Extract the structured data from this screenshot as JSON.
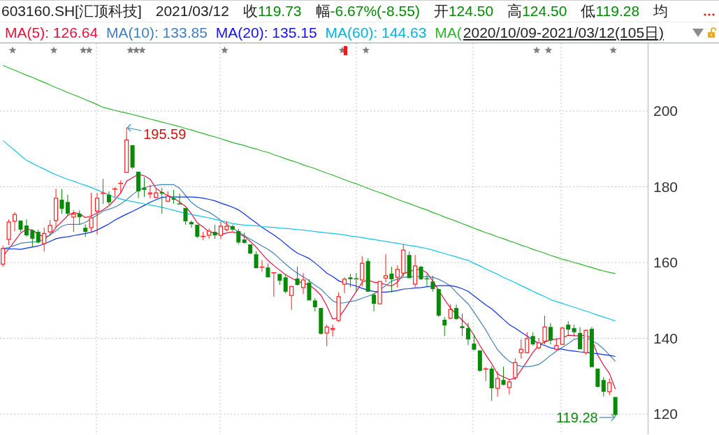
{
  "header": {
    "symbol": "603160.SH[汇顶科技]",
    "date": "2021/03/12",
    "falling": true,
    "quote_fields": [
      {
        "label": "收",
        "value": "119.73"
      },
      {
        "label": "幅",
        "value": "-6.67%(-8.55)"
      },
      {
        "label": "开",
        "value": "124.50"
      },
      {
        "label": "高",
        "value": "124.50"
      },
      {
        "label": "低",
        "value": "119.28"
      },
      {
        "label": "均"
      }
    ]
  },
  "indicator_bar": {
    "ma_items": [
      {
        "text": "MA(5): 126.64",
        "color": "#e8103a"
      },
      {
        "text": "MA(10): 133.85",
        "color": "#3f7fc0"
      },
      {
        "text": "MA(20): 135.15",
        "color": "#1212f0"
      },
      {
        "text": "MA(60): 144.63",
        "color": "#00b4d8"
      },
      {
        "text": "MA(",
        "color": "#2fb02f"
      }
    ],
    "date_range": "2020/10/09-2021/03/12(105日)"
  },
  "chart": {
    "event_marks": [
      {
        "kind": "star"
      },
      {
        "kind": "star"
      },
      {
        "kind": "star"
      },
      {
        "kind": "star"
      },
      {
        "kind": "star"
      },
      {
        "kind": "star"
      },
      {
        "kind": "star"
      },
      {
        "kind": "star"
      },
      {
        "kind": "star"
      },
      {
        "kind": "flag"
      },
      {
        "kind": "star"
      },
      {
        "kind": "star"
      },
      {
        "kind": "star"
      },
      {
        "kind": "star"
      }
    ],
    "chart_data": {
      "type": "candlestick",
      "grid": true,
      "ylim": [
        114.65,
        217.9
      ],
      "yticks": [
        120,
        140,
        160,
        180,
        200
      ],
      "categories": [
        null,
        null,
        null,
        null,
        null,
        null,
        null,
        null,
        null,
        null,
        null,
        null,
        null,
        null,
        null,
        null,
        null,
        null,
        null,
        null,
        null,
        null,
        null,
        null,
        null,
        null,
        null,
        null,
        null,
        null,
        null,
        null,
        null,
        null,
        null,
        null,
        null,
        null,
        null,
        null,
        null,
        null,
        null,
        null,
        null,
        null,
        null,
        null,
        null,
        null,
        null,
        null,
        null,
        null,
        null,
        null,
        null,
        null,
        null,
        null,
        null,
        null,
        null,
        null,
        null,
        null,
        null,
        null,
        null,
        null,
        null,
        null,
        null,
        null,
        null,
        null,
        null,
        null,
        null,
        null,
        null,
        null,
        null,
        null,
        null,
        null,
        null,
        null,
        null,
        null,
        null,
        null,
        null,
        null,
        null,
        null,
        null,
        null,
        null,
        null,
        null,
        null,
        null,
        null,
        null,
        null,
        null,
        null,
        null,
        null
      ],
      "ohlc": [
        [
          159.6,
          164.5,
          158.9,
          163.7
        ],
        [
          166.1,
          171.4,
          164.6,
          170.7
        ],
        [
          170.9,
          173.3,
          168.3,
          172.7
        ],
        [
          171.1,
          171.1,
          168.1,
          168.7
        ],
        [
          169.8,
          171.4,
          166.8,
          167.2
        ],
        [
          168.5,
          168.7,
          164.1,
          166.3
        ],
        [
          168.1,
          168.7,
          165.0,
          165.3
        ],
        [
          165.0,
          169.2,
          162.9,
          167.7
        ],
        [
          168.1,
          171.2,
          167.4,
          169.8
        ],
        [
          171.1,
          179.5,
          169.2,
          177.0
        ],
        [
          176.6,
          179.4,
          172.9,
          174.2
        ],
        [
          176.0,
          177.9,
          172.4,
          172.9
        ],
        [
          172.0,
          173.8,
          168.1,
          172.8
        ],
        [
          172.9,
          173.8,
          170.1,
          172.0
        ],
        [
          169.2,
          170.1,
          166.8,
          168.1
        ],
        [
          169.2,
          178.4,
          168.1,
          171.8
        ],
        [
          173.6,
          178.4,
          167.4,
          177.0
        ],
        [
          178.1,
          182.1,
          175.5,
          178.3
        ],
        [
          177.9,
          178.8,
          175.3,
          175.9
        ],
        [
          179.2,
          179.9,
          177.3,
          179.4
        ],
        [
          180.7,
          181.7,
          178.2,
          180.9
        ],
        [
          183.8,
          195.59,
          183.8,
          192.4
        ],
        [
          191.0,
          191.0,
          184.7,
          185.1
        ],
        [
          184.0,
          184.0,
          177.0,
          178.8
        ],
        [
          179.7,
          182.5,
          177.3,
          179.2
        ],
        [
          178.1,
          180.5,
          177.0,
          178.4
        ],
        [
          177.2,
          179.7,
          177.0,
          178.4
        ],
        [
          178.6,
          179.7,
          172.9,
          178.2
        ],
        [
          176.2,
          178.8,
          176.0,
          177.5
        ],
        [
          177.0,
          179.2,
          175.5,
          176.6
        ],
        [
          175.5,
          178.2,
          175.3,
          175.3
        ],
        [
          174.4,
          174.4,
          170.0,
          170.9
        ],
        [
          170.7,
          171.1,
          169.2,
          170.1
        ],
        [
          170.0,
          170.0,
          166.5,
          166.8
        ],
        [
          166.7,
          168.1,
          165.9,
          166.9
        ],
        [
          167.2,
          169.0,
          166.3,
          168.3
        ],
        [
          168.1,
          170.0,
          166.3,
          167.2
        ],
        [
          167.2,
          170.9,
          166.3,
          169.6
        ],
        [
          168.7,
          170.9,
          168.3,
          169.6
        ],
        [
          169.6,
          170.0,
          168.3,
          168.7
        ],
        [
          168.3,
          168.9,
          164.8,
          165.3
        ],
        [
          166.1,
          167.9,
          165.0,
          165.2
        ],
        [
          164.8,
          164.8,
          162.2,
          162.4
        ],
        [
          162.2,
          163.0,
          158.5,
          158.5
        ],
        [
          158.6,
          160.6,
          157.6,
          158.8
        ],
        [
          158.7,
          159.8,
          156.1,
          156.1
        ],
        [
          157.1,
          157.4,
          151.0,
          157.3
        ],
        [
          157.0,
          157.0,
          154.1,
          155.2
        ],
        [
          156.1,
          157.0,
          151.9,
          152.3
        ],
        [
          151.3,
          153.7,
          147.5,
          153.7
        ],
        [
          155.8,
          158.9,
          153.9,
          154.1
        ],
        [
          153.4,
          157.2,
          151.7,
          155.4
        ],
        [
          154.7,
          155.6,
          150.0,
          150.0
        ],
        [
          150.0,
          150.6,
          147.1,
          148.2
        ],
        [
          148.0,
          148.0,
          141.0,
          141.2
        ],
        [
          141.4,
          143.6,
          137.9,
          143.0
        ],
        [
          142.3,
          143.6,
          140.5,
          142.6
        ],
        [
          144.7,
          152.1,
          144.3,
          151.0
        ],
        [
          154.3,
          156.1,
          151.9,
          155.6
        ],
        [
          156.1,
          157.0,
          153.5,
          155.6
        ],
        [
          155.7,
          157.2,
          152.3,
          155.5
        ],
        [
          155.4,
          161.7,
          153.7,
          159.8
        ],
        [
          160.4,
          161.1,
          152.3,
          152.3
        ],
        [
          151.5,
          151.9,
          147.1,
          149.1
        ],
        [
          149.1,
          155.0,
          149.1,
          155.0
        ],
        [
          155.9,
          162.2,
          154.8,
          156.5
        ],
        [
          157.1,
          158.9,
          152.1,
          155.6
        ],
        [
          156.1,
          159.3,
          153.4,
          158.2
        ],
        [
          157.2,
          164.8,
          156.3,
          163.3
        ],
        [
          162.0,
          162.9,
          155.8,
          155.9
        ],
        [
          154.3,
          162.0,
          153.5,
          159.1
        ],
        [
          158.9,
          159.1,
          155.4,
          155.6
        ],
        [
          155.7,
          157.0,
          153.7,
          155.5
        ],
        [
          155.0,
          156.5,
          152.3,
          153.0
        ],
        [
          153.0,
          153.0,
          145.6,
          146.0
        ],
        [
          144.9,
          145.6,
          140.6,
          143.4
        ],
        [
          145.3,
          148.9,
          145.1,
          147.6
        ],
        [
          148.0,
          148.9,
          144.9,
          145.1
        ],
        [
          143.2,
          146.5,
          140.6,
          142.7
        ],
        [
          142.7,
          144.1,
          138.2,
          139.7
        ],
        [
          138.6,
          141.0,
          136.8,
          137.0
        ],
        [
          136.8,
          136.8,
          131.2,
          131.4
        ],
        [
          131.7,
          132.4,
          128.7,
          131.9
        ],
        [
          132.0,
          132.7,
          123.5,
          126.8
        ],
        [
          126.8,
          131.2,
          124.6,
          129.4
        ],
        [
          129.0,
          132.5,
          127.6,
          127.7
        ],
        [
          127.0,
          129.0,
          125.2,
          128.5
        ],
        [
          129.6,
          134.7,
          129.0,
          133.6
        ],
        [
          136.2,
          139.7,
          134.6,
          137.1
        ],
        [
          136.2,
          141.6,
          136.0,
          139.9
        ],
        [
          140.6,
          141.6,
          138.1,
          138.4
        ],
        [
          137.5,
          140.1,
          137.1,
          138.8
        ],
        [
          139.2,
          146.0,
          138.4,
          143.0
        ],
        [
          143.0,
          144.0,
          138.4,
          139.4
        ],
        [
          137.1,
          139.9,
          136.8,
          138.1
        ],
        [
          138.4,
          143.0,
          138.2,
          142.7
        ],
        [
          143.6,
          144.5,
          140.6,
          142.3
        ],
        [
          142.7,
          143.6,
          140.5,
          141.6
        ],
        [
          141.4,
          142.9,
          137.1,
          137.1
        ],
        [
          136.2,
          142.3,
          135.7,
          142.1
        ],
        [
          142.5,
          143.0,
          132.4,
          132.4
        ],
        [
          132.0,
          132.0,
          127.0,
          127.2
        ],
        [
          129.0,
          129.8,
          124.6,
          125.9
        ],
        [
          125.9,
          129.4,
          125.0,
          128.3
        ],
        [
          124.5,
          124.5,
          119.28,
          119.73
        ],
        null,
        null,
        null,
        null,
        null
      ],
      "series": [
        {
          "type": "line",
          "color": "#e0143c",
          "values": [
            161.7,
            163.6,
            165.7,
            167.8,
            168.8,
            168.6,
            167.5,
            166.7,
            167.2,
            169.3,
            170.8,
            172.4,
            173.2,
            172.9,
            171.9,
            172.3,
            173.1,
            173.9,
            175.0,
            176.6,
            178.4,
            181.5,
            182.4,
            183.3,
            182.9,
            182.0,
            179.6,
            178.5,
            177.7,
            177.0,
            176.0,
            174.8,
            172.9,
            170.5,
            169.4,
            168.1,
            167.8,
            167.4,
            167.8,
            168.1,
            167.6,
            166.9,
            165.6,
            164.1,
            162.3,
            160.6,
            159.2,
            158.0,
            156.8,
            155.9,
            155.1,
            154.5,
            154.1,
            152.9,
            151.4,
            148.6,
            145.1,
            145.4,
            147.6,
            150.0,
            152.4,
            154.8,
            155.4,
            154.8,
            154.6,
            154.2,
            153.8,
            154.8,
            157.0,
            157.6,
            158.1,
            158.2,
            157.3,
            155.1,
            152.7,
            150.2,
            148.0,
            146.3,
            144.8,
            143.2,
            140.8,
            138.1,
            135.6,
            133.3,
            130.6,
            129.8,
            129.1,
            129.4,
            131.6,
            133.9,
            136.3,
            138.2,
            139.0,
            139.6,
            139.8,
            140.1,
            140.8,
            140.7,
            140.6,
            140.9,
            139.8,
            135.6,
            132.9,
            130.7,
            126.6,
            null,
            null,
            null,
            null,
            null
          ]
        },
        {
          "type": "line",
          "color": "#4682b4",
          "values": [
            163.7,
            164.0,
            164.5,
            165.1,
            165.3,
            165.4,
            165.5,
            166.2,
            167.3,
            168.4,
            169.6,
            170.1,
            170.1,
            170.1,
            170.6,
            171.6,
            172.5,
            173.6,
            174.1,
            174.6,
            175.5,
            176.6,
            177.9,
            179.1,
            179.8,
            180.2,
            180.4,
            180.6,
            180.6,
            180.6,
            179.6,
            177.7,
            175.9,
            174.7,
            173.9,
            173.3,
            172.3,
            171.1,
            170.1,
            169.1,
            168.1,
            167.1,
            166.2,
            165.3,
            164.4,
            163.5,
            162.4,
            161.0,
            159.6,
            158.3,
            157.2,
            156.2,
            155.2,
            154.0,
            153.0,
            151.4,
            149.9,
            149.2,
            149.4,
            149.7,
            150.0,
            150.6,
            151.1,
            151.7,
            152.8,
            153.9,
            155.1,
            155.6,
            156.1,
            156.2,
            156.3,
            156.3,
            156.3,
            156.1,
            155.6,
            154.8,
            153.8,
            152.1,
            150.6,
            149.1,
            146.9,
            144.6,
            142.2,
            139.5,
            137.0,
            135.3,
            133.9,
            133.1,
            132.6,
            132.5,
            132.7,
            133.1,
            134.2,
            135.5,
            136.6,
            137.6,
            138.6,
            139.7,
            140.1,
            140.1,
            139.4,
            138.5,
            137.2,
            135.6,
            133.9,
            null,
            null,
            null,
            null,
            null
          ]
        },
        {
          "type": "line",
          "color": "#0b2ff0",
          "values": [
            163.7,
            163.6,
            163.6,
            163.5,
            163.8,
            164.1,
            164.4,
            164.9,
            165.6,
            166.3,
            166.6,
            166.8,
            167.1,
            167.4,
            167.7,
            168.0,
            168.6,
            169.4,
            170.2,
            171.2,
            172.0,
            172.8,
            173.5,
            174.3,
            175.1,
            175.9,
            176.6,
            177.2,
            177.3,
            177.3,
            177.3,
            177.3,
            177.3,
            177.2,
            177.0,
            176.7,
            176.3,
            175.7,
            175.2,
            174.6,
            173.9,
            172.8,
            171.6,
            170.5,
            169.3,
            168.3,
            167.3,
            166.2,
            164.9,
            163.6,
            162.5,
            161.8,
            161.1,
            159.9,
            158.6,
            157.2,
            156.3,
            155.2,
            154.6,
            154.2,
            153.8,
            153.2,
            152.7,
            152.4,
            152.2,
            152.2,
            152.4,
            152.6,
            153.0,
            153.1,
            153.3,
            153.4,
            153.6,
            153.7,
            153.9,
            153.9,
            153.9,
            153.6,
            153.1,
            152.4,
            151.2,
            150.0,
            148.8,
            147.8,
            146.4,
            145.0,
            143.6,
            142.7,
            141.6,
            140.6,
            139.6,
            138.6,
            138.1,
            137.5,
            137.2,
            137.1,
            136.8,
            136.6,
            136.4,
            136.3,
            136.1,
            135.9,
            135.7,
            135.5,
            135.2,
            null,
            null,
            null,
            null,
            null
          ]
        },
        {
          "type": "line",
          "color": "#12c4e4",
          "values": [
            192.2,
            190.9,
            189.6,
            188.3,
            187.0,
            186.2,
            185.4,
            184.7,
            183.9,
            183.2,
            182.6,
            182.0,
            181.5,
            180.9,
            180.4,
            179.8,
            179.2,
            178.5,
            177.9,
            177.2,
            176.8,
            176.4,
            176.1,
            175.8,
            175.5,
            175.2,
            174.9,
            174.6,
            174.2,
            173.8,
            173.4,
            173.0,
            172.7,
            172.4,
            172.1,
            171.8,
            171.4,
            171.1,
            170.7,
            170.3,
            170.1,
            169.9,
            169.8,
            169.7,
            169.5,
            169.4,
            169.3,
            169.1,
            169.0,
            168.9,
            168.7,
            168.6,
            168.4,
            168.2,
            168.0,
            167.8,
            167.7,
            167.5,
            167.3,
            167.0,
            166.8,
            166.6,
            166.3,
            166.1,
            165.8,
            165.6,
            165.3,
            165.1,
            164.8,
            164.5,
            164.3,
            164.0,
            163.7,
            163.3,
            162.8,
            162.4,
            161.9,
            161.5,
            161.0,
            160.6,
            159.8,
            159.1,
            158.3,
            157.6,
            156.9,
            156.1,
            155.4,
            154.7,
            153.9,
            153.2,
            152.4,
            151.7,
            151.0,
            150.2,
            149.7,
            149.2,
            148.7,
            148.2,
            147.7,
            147.2,
            146.7,
            146.1,
            145.6,
            145.1,
            144.6,
            null,
            null,
            null,
            null,
            null
          ]
        },
        {
          "type": "line",
          "color": "#2db32d",
          "values": [
            212.1,
            211.4,
            210.8,
            210.1,
            209.5,
            208.9,
            208.2,
            207.6,
            206.9,
            206.2,
            205.6,
            204.9,
            204.3,
            203.7,
            203.0,
            202.4,
            201.7,
            201.0,
            200.6,
            200.2,
            199.8,
            199.5,
            199.1,
            198.7,
            198.3,
            197.9,
            197.5,
            197.1,
            196.7,
            196.3,
            195.9,
            195.4,
            195.0,
            194.5,
            194.1,
            193.6,
            193.2,
            192.7,
            192.2,
            191.7,
            191.3,
            190.9,
            190.4,
            190.0,
            189.5,
            189.1,
            188.5,
            188.0,
            187.4,
            186.9,
            186.4,
            185.8,
            185.3,
            184.8,
            184.2,
            183.6,
            183.1,
            182.5,
            181.9,
            181.3,
            180.8,
            180.2,
            179.6,
            179.0,
            178.5,
            177.9,
            177.3,
            176.7,
            176.1,
            175.6,
            175.0,
            174.4,
            173.9,
            173.2,
            172.7,
            172.0,
            171.5,
            170.9,
            170.3,
            169.7,
            169.1,
            168.5,
            167.9,
            167.4,
            166.8,
            166.3,
            165.7,
            165.2,
            164.6,
            164.1,
            163.5,
            163.0,
            162.5,
            161.9,
            161.4,
            160.9,
            160.5,
            160.0,
            159.6,
            159.1,
            158.7,
            158.2,
            157.8,
            157.4,
            157.1,
            null,
            null,
            null,
            null,
            null
          ]
        }
      ],
      "annotations": [
        {
          "text": "195.59"
        },
        {
          "text": "119.28"
        }
      ]
    }
  }
}
